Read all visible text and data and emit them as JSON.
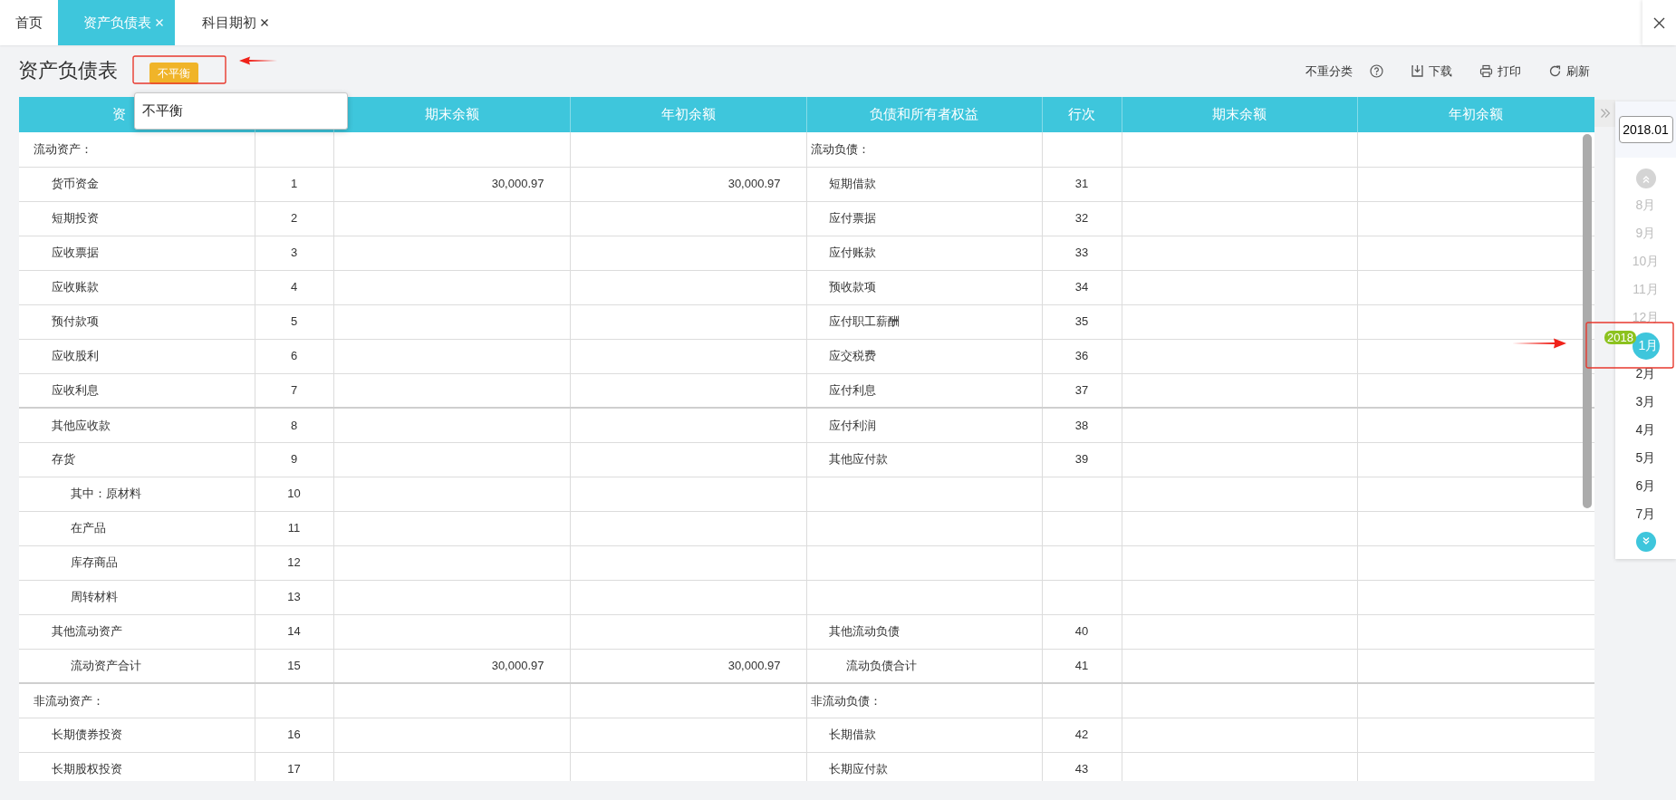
{
  "tabs": [
    {
      "label": "首页",
      "closable": false,
      "selected": false
    },
    {
      "label": "资产负债表",
      "closable": true,
      "selected": true
    },
    {
      "label": "科目期初",
      "closable": true,
      "selected": false
    }
  ],
  "page": {
    "title": "资产负债表",
    "status_badge": "不平衡",
    "popover": "不平衡"
  },
  "toolbar": [
    {
      "kind": "help",
      "label": "不重分类"
    },
    {
      "kind": "download",
      "label": "下载"
    },
    {
      "kind": "print",
      "label": "打印"
    },
    {
      "kind": "refresh",
      "label": "刷新"
    }
  ],
  "table": {
    "columns": [
      "资",
      null,
      "期末余额",
      "年初余额",
      "负债和所有者权益",
      "行次",
      "期末余额",
      "年初余额"
    ],
    "rows": [
      {
        "left": {
          "kind": "section",
          "name": "流动资产："
        },
        "right": {
          "kind": "section",
          "name": "流动负债："
        },
        "rule_below": false
      },
      {
        "left": {
          "kind": "item",
          "name": "货币资金",
          "line": "1",
          "end_balance": "30,000.97",
          "start_balance": "30,000.97"
        },
        "right": {
          "kind": "item",
          "name": "短期借款",
          "line": "31"
        },
        "rule_below": false
      },
      {
        "left": {
          "kind": "item",
          "name": "短期投资",
          "line": "2"
        },
        "right": {
          "kind": "item",
          "name": "应付票据",
          "line": "32"
        },
        "rule_below": false
      },
      {
        "left": {
          "kind": "item",
          "name": "应收票据",
          "line": "3"
        },
        "right": {
          "kind": "item",
          "name": "应付账款",
          "line": "33"
        },
        "rule_below": false
      },
      {
        "left": {
          "kind": "item",
          "name": "应收账款",
          "line": "4"
        },
        "right": {
          "kind": "item",
          "name": "预收款项",
          "line": "34"
        },
        "rule_below": false
      },
      {
        "left": {
          "kind": "item",
          "name": "预付款项",
          "line": "5"
        },
        "right": {
          "kind": "item",
          "name": "应付职工薪酬",
          "line": "35"
        },
        "rule_below": false
      },
      {
        "left": {
          "kind": "item",
          "name": "应收股利",
          "line": "6"
        },
        "right": {
          "kind": "item",
          "name": "应交税费",
          "line": "36"
        },
        "rule_below": false
      },
      {
        "left": {
          "kind": "item",
          "name": "应收利息",
          "line": "7"
        },
        "right": {
          "kind": "item",
          "name": "应付利息",
          "line": "37"
        },
        "rule_below": true
      },
      {
        "left": {
          "kind": "item",
          "name": "其他应收款",
          "line": "8"
        },
        "right": {
          "kind": "item",
          "name": "应付利润",
          "line": "38"
        },
        "rule_below": false
      },
      {
        "left": {
          "kind": "item",
          "name": "存货",
          "line": "9"
        },
        "right": {
          "kind": "item",
          "name": "其他应付款",
          "line": "39"
        },
        "rule_below": false
      },
      {
        "left": {
          "kind": "subitem",
          "name": "其中：原材料",
          "line": "10"
        },
        "rule_below": false
      },
      {
        "left": {
          "kind": "subitem",
          "name": "在产品",
          "line": "11"
        },
        "rule_below": false
      },
      {
        "left": {
          "kind": "subitem",
          "name": "库存商品",
          "line": "12"
        },
        "rule_below": false
      },
      {
        "left": {
          "kind": "subitem",
          "name": "周转材料",
          "line": "13"
        },
        "rule_below": false
      },
      {
        "left": {
          "kind": "item",
          "name": "其他流动资产",
          "line": "14"
        },
        "right": {
          "kind": "item",
          "name": "其他流动负债",
          "line": "40"
        },
        "rule_below": false
      },
      {
        "left": {
          "kind": "total",
          "name": "流动资产合计",
          "line": "15",
          "end_balance": "30,000.97",
          "start_balance": "30,000.97"
        },
        "right": {
          "kind": "total",
          "name": "流动负债合计",
          "line": "41"
        },
        "rule_below": true
      },
      {
        "left": {
          "kind": "section",
          "name": "非流动资产："
        },
        "right": {
          "kind": "section",
          "name": "非流动负债："
        },
        "rule_below": false
      },
      {
        "left": {
          "kind": "item",
          "name": "长期债券投资",
          "line": "16"
        },
        "right": {
          "kind": "item",
          "name": "长期借款",
          "line": "42"
        },
        "rule_below": false
      },
      {
        "left": {
          "kind": "item",
          "name": "长期股权投资",
          "line": "17"
        },
        "right": {
          "kind": "item",
          "name": "长期应付款",
          "line": "43"
        },
        "rule_below": false
      }
    ]
  },
  "period_panel": {
    "period": "2018.01",
    "scroll_up": {
      "disabled": true
    },
    "scroll_down": {
      "disabled": false
    },
    "months": [
      {
        "label": "8月",
        "dimmed": true,
        "selected": false
      },
      {
        "label": "9月",
        "dimmed": true,
        "selected": false
      },
      {
        "label": "10月",
        "dimmed": true,
        "selected": false
      },
      {
        "label": "11月",
        "dimmed": true,
        "selected": false
      },
      {
        "label": "12月",
        "dimmed": true,
        "selected": false
      },
      {
        "label": "1月",
        "dimmed": false,
        "selected": true,
        "year_badge": "2018"
      },
      {
        "label": "2月",
        "dimmed": false,
        "selected": false
      },
      {
        "label": "3月",
        "dimmed": false,
        "selected": false
      },
      {
        "label": "4月",
        "dimmed": false,
        "selected": false
      },
      {
        "label": "5月",
        "dimmed": false,
        "selected": false
      },
      {
        "label": "6月",
        "dimmed": false,
        "selected": false
      },
      {
        "label": "7月",
        "dimmed": false,
        "selected": false
      }
    ]
  }
}
